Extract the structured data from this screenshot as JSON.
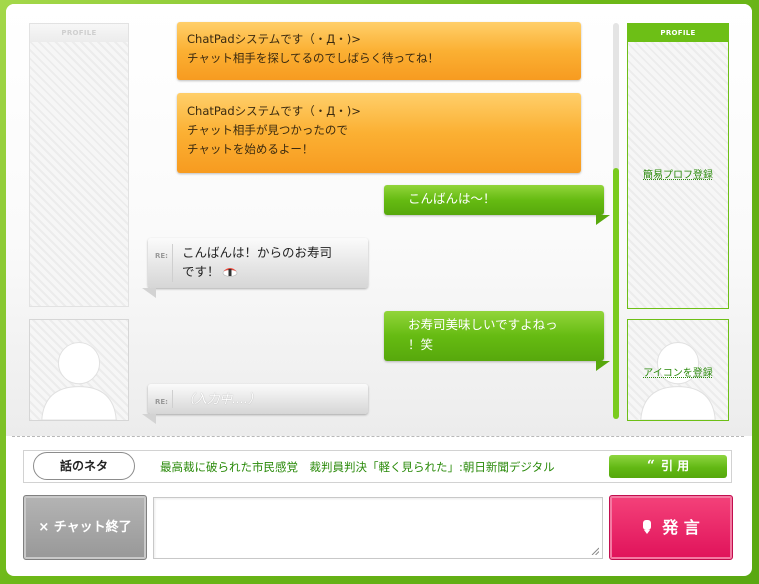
{
  "left_profile": {
    "header": "PROFILE"
  },
  "right_profile": {
    "header": "PROFILE",
    "register_profile_link": "簡易プロフ登録",
    "register_icon_link": "アイコンを登録"
  },
  "messages": {
    "system": [
      {
        "lines": [
          "ChatPadシステムです（・Д・)>",
          "チャット相手を探してるのでしばらく待ってね！"
        ]
      },
      {
        "lines": [
          "ChatPadシステムです（・Д・)>",
          "チャット相手が見つかったので",
          "チャットを始めるよー！"
        ]
      }
    ],
    "self_1": "こんばんは〜！",
    "partner_1_lines": [
      "こんばんは！からのお寿司",
      "です！"
    ],
    "self_2_lines": [
      "お寿司美味しいですよねっ",
      "！笑"
    ],
    "partner_typing": "（入力中....）",
    "re_label": "RE:"
  },
  "topic": {
    "label": "話のネタ",
    "headline": "最高裁に破られた市民感覚　裁判員判決「軽く見られた」:朝日新聞デジタル",
    "quote_button": "引 用",
    "quote_mark": "“"
  },
  "controls": {
    "end_chat_button": "× チャット終了",
    "message_input_value": "",
    "send_button": "発 言"
  },
  "colors": {
    "brand_green": "#6dbf16",
    "system_orange": "#fbb033",
    "send_pink": "#e0125a",
    "end_gray": "#989898"
  }
}
